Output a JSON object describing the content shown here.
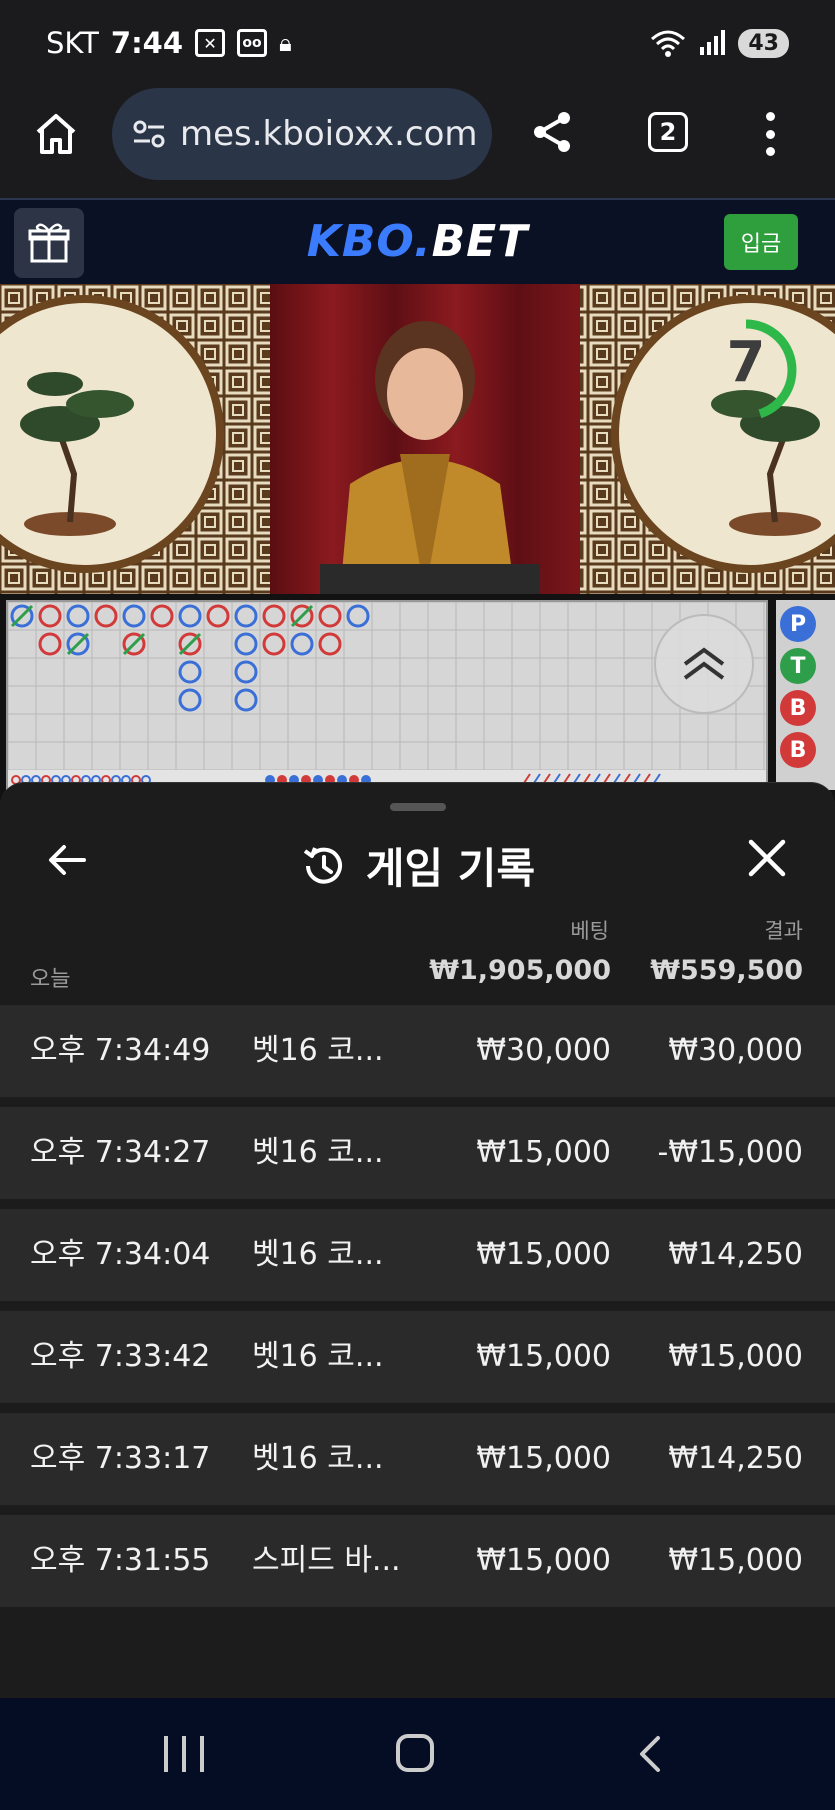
{
  "status_bar": {
    "carrier": "SKT",
    "time": "7:44",
    "battery": "43"
  },
  "browser": {
    "url": "mes.kboioxx.com",
    "tab_count": "2"
  },
  "site": {
    "logo_part1": "KBO.",
    "logo_part2": "BET",
    "deposit_label": "입금",
    "brand_color": "#3b7cff",
    "deposit_color": "#2f9e3c"
  },
  "video": {
    "countdown": "7",
    "countdown_fraction": 0.45
  },
  "side_road": {
    "beads": [
      "P",
      "T",
      "B",
      "B"
    ]
  },
  "history_sheet": {
    "title": "게임 기록",
    "today_label": "오늘",
    "bet_header": "베팅",
    "result_header": "결과",
    "total_bet": "₩1,905,000",
    "total_result": "₩559,500",
    "rows": [
      {
        "time": "오후 7:34:49",
        "game": "벳16 코...",
        "bet": "₩30,000",
        "result": "₩30,000"
      },
      {
        "time": "오후 7:34:27",
        "game": "벳16 코...",
        "bet": "₩15,000",
        "result": "-₩15,000"
      },
      {
        "time": "오후 7:34:04",
        "game": "벳16 코...",
        "bet": "₩15,000",
        "result": "₩14,250"
      },
      {
        "time": "오후 7:33:42",
        "game": "벳16 코...",
        "bet": "₩15,000",
        "result": "₩15,000"
      },
      {
        "time": "오후 7:33:17",
        "game": "벳16 코...",
        "bet": "₩15,000",
        "result": "₩14,250"
      },
      {
        "time": "오후 7:31:55",
        "game": "스피드 바...",
        "bet": "₩15,000",
        "result": "₩15,000"
      }
    ]
  },
  "icons": {
    "home": "home-icon",
    "site_info": "site-info-icon",
    "share": "share-icon",
    "menu": "more-vert-icon",
    "gift": "gift-icon",
    "back": "arrow-left-icon",
    "history": "history-icon",
    "close": "close-icon"
  }
}
